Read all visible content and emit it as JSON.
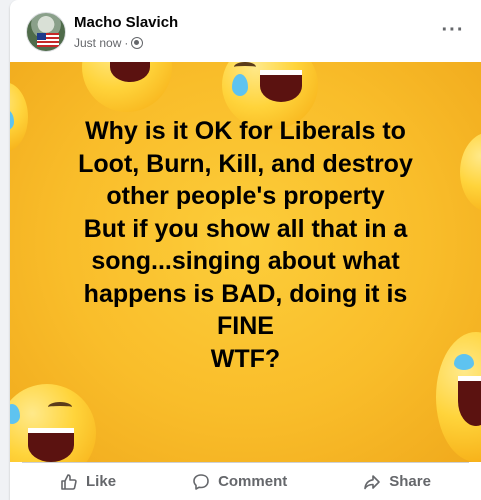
{
  "post": {
    "author": "Macho Slavich",
    "timestamp": "Just now",
    "separator": "·",
    "privacy_icon": "globe-icon",
    "more_icon": "more-options-icon",
    "more_glyph": "···",
    "image_text_lines": [
      "Why is it OK for Liberals to",
      "Loot, Burn, Kill, and destroy",
      "other people's property",
      "But if you show all that in a",
      "song...singing about what",
      "happens is BAD, doing it is",
      "FINE",
      "WTF?"
    ],
    "image_background": "#f9bd2a",
    "emoji_decoration": "laughing-tears-emoji"
  },
  "actions": {
    "like_label": "Like",
    "comment_label": "Comment",
    "share_label": "Share",
    "like_icon": "thumbs-up-icon",
    "comment_icon": "comment-bubble-icon",
    "share_icon": "share-arrow-icon"
  },
  "colors": {
    "name_text": "#050505",
    "secondary_text": "#65676b",
    "divider": "#ced0d4"
  }
}
